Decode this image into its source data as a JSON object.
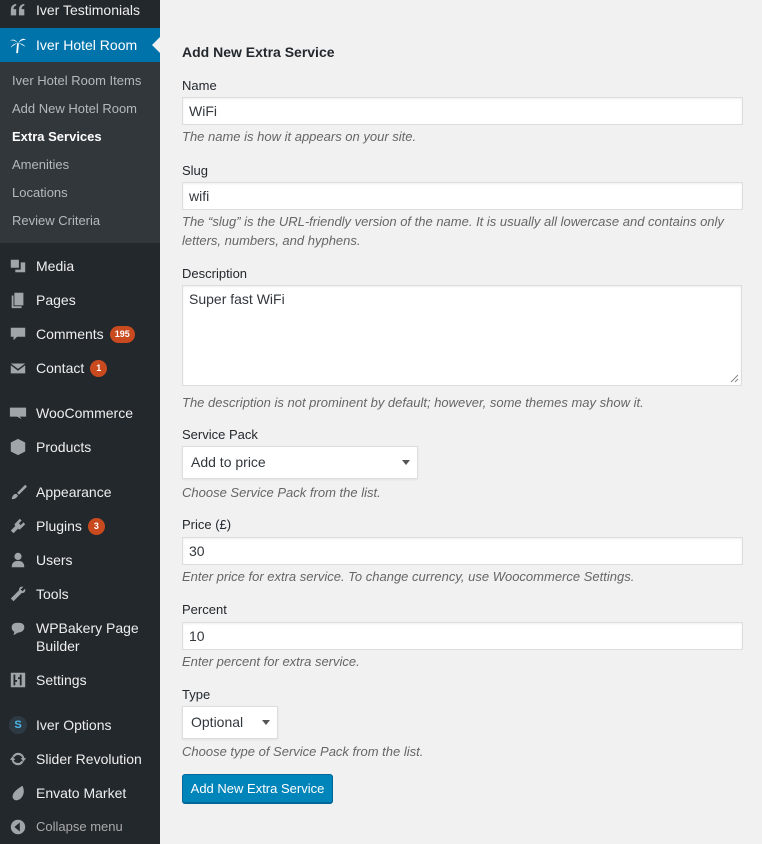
{
  "sidebar": {
    "top_item": {
      "label": "Iver Testimonials",
      "icon": "quote-icon"
    },
    "current_item": {
      "label": "Iver Hotel Room",
      "icon": "palm-tree-icon"
    },
    "submenu": [
      {
        "label": "Iver Hotel Room Items"
      },
      {
        "label": "Add New Hotel Room"
      },
      {
        "label": "Extra Services"
      },
      {
        "label": "Amenities"
      },
      {
        "label": "Locations"
      },
      {
        "label": "Review Criteria"
      }
    ],
    "items": [
      {
        "label": "Media",
        "icon": "media-icon"
      },
      {
        "label": "Pages",
        "icon": "pages-icon"
      },
      {
        "label": "Comments",
        "icon": "comments-icon",
        "badge": "195"
      },
      {
        "label": "Contact",
        "icon": "mail-icon",
        "badge": "1"
      },
      {
        "label": "WooCommerce",
        "icon": "woocommerce-icon"
      },
      {
        "label": "Products",
        "icon": "products-icon"
      },
      {
        "label": "Appearance",
        "icon": "paintbrush-icon"
      },
      {
        "label": "Plugins",
        "icon": "plugins-icon",
        "badge": "3"
      },
      {
        "label": "Users",
        "icon": "users-icon"
      },
      {
        "label": "Tools",
        "icon": "wrench-icon"
      },
      {
        "label": "WPBakery Page Builder",
        "icon": "wpbakery-icon"
      },
      {
        "label": "Settings",
        "icon": "settings-icon"
      },
      {
        "label": "Iver Options",
        "icon": "iver-options-icon",
        "icon_letter": "S"
      },
      {
        "label": "Slider Revolution",
        "icon": "refresh-icon"
      },
      {
        "label": "Envato Market",
        "icon": "leaf-icon"
      },
      {
        "label": "Collapse menu",
        "icon": "collapse-icon"
      }
    ]
  },
  "form": {
    "title": "Add New Extra Service",
    "name": {
      "label": "Name",
      "value": "WiFi",
      "description": "The name is how it appears on your site."
    },
    "slug": {
      "label": "Slug",
      "value": "wifi",
      "description": "The “slug” is the URL-friendly version of the name. It is usually all lowercase and contains only letters, numbers, and hyphens."
    },
    "description": {
      "label": "Description",
      "value": "Super fast WiFi",
      "description": "The description is not prominent by default; however, some themes may show it."
    },
    "service_pack": {
      "label": "Service Pack",
      "selected": "Add to price",
      "description": "Choose Service Pack from the list."
    },
    "price": {
      "label": "Price (£)",
      "value": "30",
      "description": "Enter price for extra service. To change currency, use Woocommerce Settings."
    },
    "percent": {
      "label": "Percent",
      "value": "10",
      "description": "Enter percent for extra service."
    },
    "type": {
      "label": "Type",
      "selected": "Optional",
      "description": "Choose type of Service Pack from the list."
    },
    "submit_label": "Add New Extra Service"
  },
  "colors": {
    "sidebar_bg": "#23282d",
    "submenu_bg": "#32373c",
    "accent": "#0073aa",
    "badge": "#ca4a1f",
    "button": "#0085ba"
  }
}
